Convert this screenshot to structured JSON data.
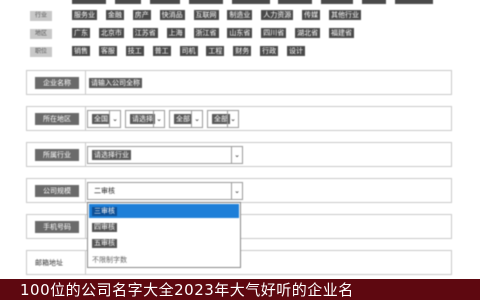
{
  "categories": [
    {
      "label": "",
      "items": [
        "",
        "",
        "",
        "",
        "",
        "",
        "",
        "",
        ""
      ]
    },
    {
      "label": "行业",
      "items": [
        "服务业",
        "金融",
        "房产",
        "快消品",
        "互联网",
        "制造业",
        "人力资源",
        "传媒",
        "其他行业"
      ]
    },
    {
      "label": "地区",
      "items": [
        "广东",
        "北京市",
        "江苏省",
        "上海",
        "浙江省",
        "山东省",
        "四川省",
        "湖北省",
        "福建省"
      ]
    },
    {
      "label": "职位",
      "items": [
        "销售",
        "客服",
        "技工",
        "普工",
        "司机",
        "工程",
        "财务",
        "行政",
        "设计"
      ]
    }
  ],
  "form": {
    "company_name": {
      "label": "企业名称",
      "value": "请输入公司全称"
    },
    "location": {
      "label": "所在地区",
      "province": "全国",
      "city": "请选择",
      "district": "全部",
      "street": "全部"
    },
    "industry": {
      "label": "所属行业",
      "value": "请选择行业"
    },
    "size": {
      "label": "公司规模",
      "value": "二审核"
    },
    "contact": {
      "label": "手机号码"
    },
    "email": {
      "label": "邮箱地址"
    }
  },
  "dropdown": {
    "options": [
      "三审核",
      "四审核",
      "五审核"
    ],
    "selected": "三审核",
    "hint": "不限制字数"
  },
  "caption": "100位的公司名字大全2023年大气好听的企业名"
}
